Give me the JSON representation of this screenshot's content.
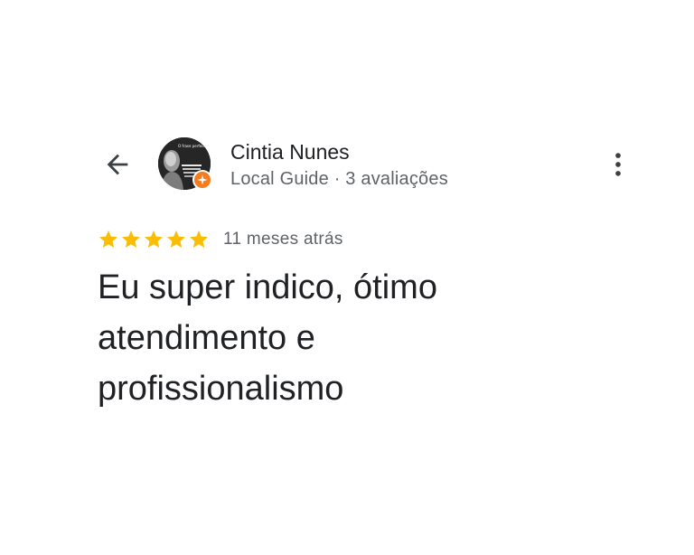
{
  "header": {
    "back_icon": "arrow-left-icon",
    "more_icon": "more-vert-icon"
  },
  "reviewer": {
    "name": "Cintia Nunes",
    "meta": "Local Guide · 3 avaliações",
    "avatar_caption": "O frase perfeita",
    "badge_icon": "local-guide-badge-icon",
    "badge_color": "#f57c1f"
  },
  "review": {
    "rating": 5,
    "max_rating": 5,
    "star_color": "#fbbc04",
    "date": "11 meses atrás",
    "text": "Eu super indico, ótimo atendimento e profissionalismo"
  }
}
